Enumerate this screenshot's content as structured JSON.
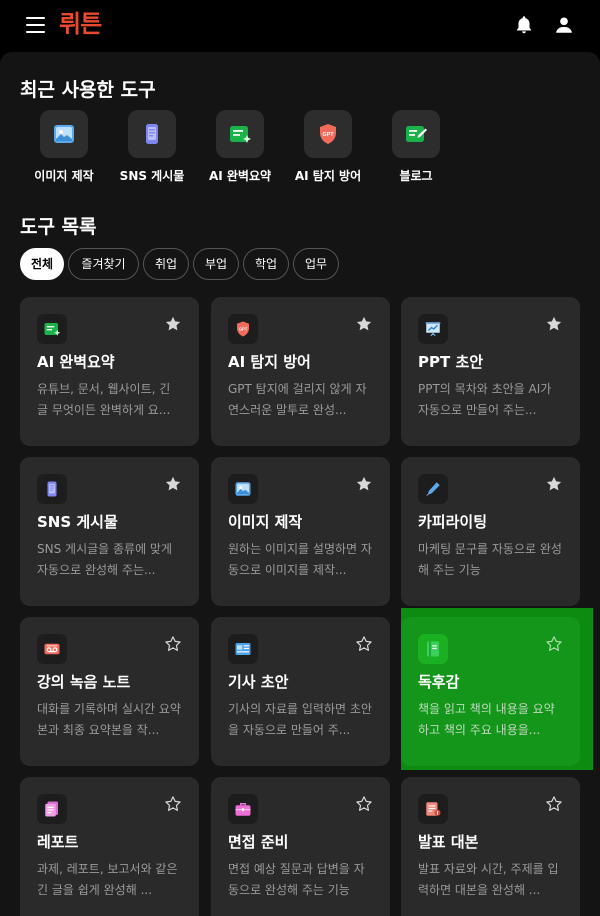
{
  "app": {
    "logo_text": "뤼튼"
  },
  "header": {
    "menu_icon": "hamburger-icon",
    "notification_icon": "bell-icon",
    "profile_icon": "user-icon"
  },
  "recent": {
    "title": "최근 사용한 도구",
    "items": [
      {
        "label": "이미지 제작",
        "icon": "image-icon"
      },
      {
        "label": "SNS 게시물",
        "icon": "phone-icon"
      },
      {
        "label": "AI 완벽요약",
        "icon": "summary-icon"
      },
      {
        "label": "AI 탐지 방어",
        "icon": "gpt-shield-icon"
      },
      {
        "label": "블로그",
        "icon": "blog-edit-icon"
      }
    ]
  },
  "tools": {
    "title": "도구 목록",
    "filters": [
      {
        "label": "전체",
        "active": true
      },
      {
        "label": "즐겨찾기",
        "active": false
      },
      {
        "label": "취업",
        "active": false
      },
      {
        "label": "부업",
        "active": false
      },
      {
        "label": "학업",
        "active": false
      },
      {
        "label": "업무",
        "active": false
      }
    ],
    "cards": [
      {
        "title": "AI 완벽요약",
        "desc": "유튜브, 문서, 웹사이트, 긴 글 무엇이든 완벽하게 요...",
        "icon": "summary-icon",
        "favorite": true
      },
      {
        "title": "AI 탐지 방어",
        "desc": "GPT 탐지에 걸리지 않게 자연스러운 말투로 완성...",
        "icon": "gpt-shield-icon",
        "favorite": true
      },
      {
        "title": "PPT 초안",
        "desc": "PPT의 목차와 초안을 AI가 자동으로 만들어 주는...",
        "icon": "presentation-icon",
        "favorite": true
      },
      {
        "title": "SNS 게시물",
        "desc": "SNS 게시글을 종류에 맞게 자동으로 완성해 주는...",
        "icon": "phone-icon",
        "favorite": true
      },
      {
        "title": "이미지 제작",
        "desc": "원하는 이미지를 설명하면 자동으로 이미지를 제작...",
        "icon": "image-icon",
        "favorite": true
      },
      {
        "title": "카피라이팅",
        "desc": "마케팅 문구를 자동으로 완성해 주는 기능",
        "icon": "pen-icon",
        "favorite": true
      },
      {
        "title": "강의 녹음 노트",
        "desc": "대화를 기록하며 실시간 요약본과 최종 요약본을 작...",
        "icon": "recorder-icon",
        "favorite": false
      },
      {
        "title": "기사 초안",
        "desc": "기사의 자료를 입력하면 초안을 자동으로 만들어 주...",
        "icon": "newspaper-icon",
        "favorite": false
      },
      {
        "title": "독후감",
        "desc": "책을 읽고 책의 내용을 요약하고 책의 주요 내용을...",
        "icon": "book-icon",
        "favorite": false
      },
      {
        "title": "레포트",
        "desc": "과제, 레포트, 보고서와 같은 긴 글을 쉽게 완성해 ...",
        "icon": "report-icon",
        "favorite": false
      },
      {
        "title": "면접 준비",
        "desc": "면접 예상 질문과 답변을 자동으로 완성해 주는 기능",
        "icon": "briefcase-icon",
        "favorite": false
      },
      {
        "title": "발표 대본",
        "desc": "발표 자료와 시간, 주제를 입력하면 대본을 완성해 ...",
        "icon": "script-icon",
        "favorite": false
      }
    ]
  },
  "colors": {
    "brand": "#e8492f",
    "card_bg": "#2a2a2a",
    "highlight_green": "#14961a",
    "star_filled": "#d8d8d8"
  }
}
